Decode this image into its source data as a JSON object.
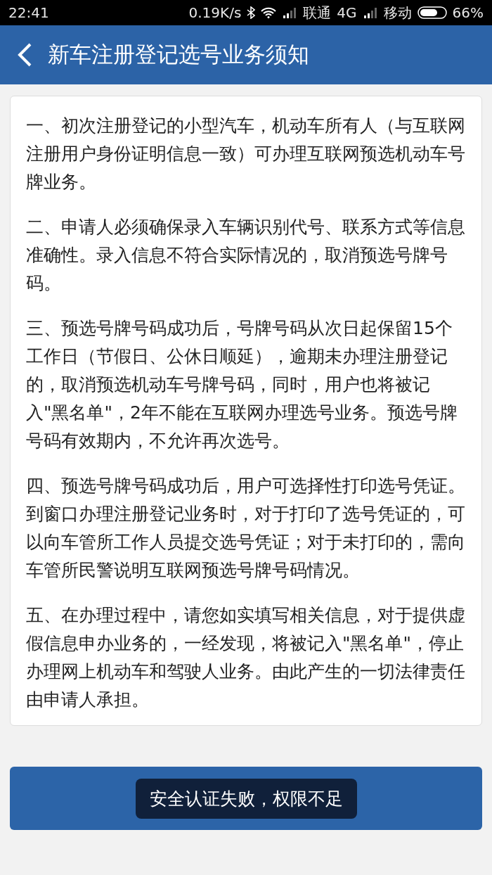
{
  "status_bar": {
    "time": "22:41",
    "speed": "0.19K/s",
    "carrier_1": "联通",
    "network": "4G",
    "carrier_2": "移动",
    "battery": "66%"
  },
  "header": {
    "title": "新车注册登记选号业务须知"
  },
  "notice": {
    "paragraphs": [
      "一、初次注册登记的小型汽车，机动车所有人（与互联网注册用户身份证明信息一致）可办理互联网预选机动车号牌业务。",
      "二、申请人必须确保录入车辆识别代号、联系方式等信息准确性。录入信息不符合实际情况的，取消预选号牌号码。",
      "三、预选号牌号码成功后，号牌号码从次日起保留15个工作日（节假日、公休日顺延），逾期未办理注册登记的，取消预选机动车号牌号码，同时，用户也将被记入\"黑名单\"，2年不能在互联网办理选号业务。预选号牌号码有效期内，不允许再次选号。",
      "四、预选号牌号码成功后，用户可选择性打印选号凭证。到窗口办理注册登记业务时，对于打印了选号凭证的，可以向车管所工作人员提交选号凭证；对于未打印的，需向车管所民警说明互联网预选号牌号码情况。",
      "五、在办理过程中，请您如实填写相关信息，对于提供虚假信息申办业务的，一经发现，将被记入\"黑名单\"，停止办理网上机动车和驾驶人业务。由此产生的一切法律责任由申请人承担。"
    ]
  },
  "toast": {
    "message": "安全认证失败，权限不足"
  }
}
